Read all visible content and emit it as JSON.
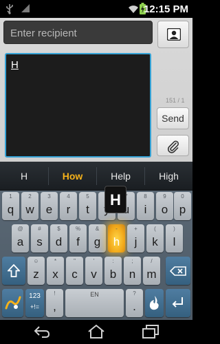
{
  "status_bar": {
    "time": "12:15 PM",
    "icons": [
      "usb-icon",
      "wifi-icon",
      "signal-icon",
      "battery-charging-icon"
    ]
  },
  "compose": {
    "recipient_placeholder": "Enter recipient",
    "message_text": "H",
    "char_counter": "151 / 1",
    "send_label": "Send",
    "contact_icon": "contact-card-icon",
    "attach_icon": "paperclip-icon"
  },
  "keyboard": {
    "suggestions": [
      "H",
      "How",
      "Help",
      "High"
    ],
    "selected_suggestion": "How",
    "popup_letter": "H",
    "row1": [
      {
        "key": "q",
        "hint": "1"
      },
      {
        "key": "w",
        "hint": "2"
      },
      {
        "key": "e",
        "hint": "3"
      },
      {
        "key": "r",
        "hint": "4"
      },
      {
        "key": "t",
        "hint": "5"
      },
      {
        "key": "y",
        "hint": "6"
      },
      {
        "key": "u",
        "hint": "7"
      },
      {
        "key": "i",
        "hint": "8"
      },
      {
        "key": "o",
        "hint": "9"
      },
      {
        "key": "p",
        "hint": "0"
      }
    ],
    "row2": [
      {
        "key": "a",
        "hint": "@"
      },
      {
        "key": "s",
        "hint": "#"
      },
      {
        "key": "d",
        "hint": "$"
      },
      {
        "key": "f",
        "hint": "%"
      },
      {
        "key": "g",
        "hint": "&"
      },
      {
        "key": "h",
        "hint": "-"
      },
      {
        "key": "j",
        "hint": "+"
      },
      {
        "key": "k",
        "hint": "("
      },
      {
        "key": "l",
        "hint": ")"
      }
    ],
    "row3": [
      {
        "key": "z",
        "hint": "☺"
      },
      {
        "key": "x",
        "hint": "*"
      },
      {
        "key": "c",
        "hint": "\""
      },
      {
        "key": "v",
        "hint": "'"
      },
      {
        "key": "b",
        "hint": ":"
      },
      {
        "key": "n",
        "hint": ";"
      },
      {
        "key": "m",
        "hint": "/"
      }
    ],
    "symbols_label": "123",
    "symbols_sublabel": "+!=",
    "comma_label": ",",
    "comma_hint": "!",
    "space_label": "EN",
    "period_label": ".",
    "period_hint": "?",
    "highlight_key": "h",
    "colors": {
      "accent": "#f6b21a",
      "dark_key": "#3f6a8c",
      "focus_border": "#36a3d6"
    }
  },
  "nav_bar": {
    "icons": [
      "back-icon",
      "home-icon",
      "recent-apps-icon"
    ]
  }
}
